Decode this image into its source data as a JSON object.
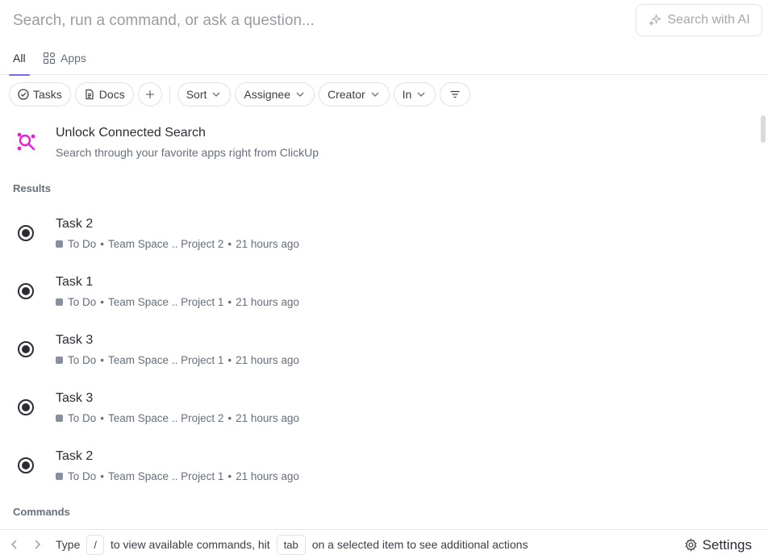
{
  "search": {
    "placeholder": "Search, run a command, or ask a question...",
    "ai_button_label": "Search with AI"
  },
  "tabs": [
    {
      "label": "All",
      "active": true
    },
    {
      "label": "Apps",
      "active": false
    }
  ],
  "filters": {
    "tasks_label": "Tasks",
    "docs_label": "Docs",
    "sort_label": "Sort",
    "assignee_label": "Assignee",
    "creator_label": "Creator",
    "in_label": "In"
  },
  "promo": {
    "title": "Unlock Connected Search",
    "subtitle": "Search through your favorite apps right from ClickUp"
  },
  "sections": {
    "results_label": "Results",
    "commands_label": "Commands"
  },
  "results": [
    {
      "title": "Task 2",
      "status": "To Do",
      "space": "Team Space",
      "project": "Project 2",
      "time": "21 hours ago"
    },
    {
      "title": "Task 1",
      "status": "To Do",
      "space": "Team Space",
      "project": "Project 1",
      "time": "21 hours ago"
    },
    {
      "title": "Task 3",
      "status": "To Do",
      "space": "Team Space",
      "project": "Project 1",
      "time": "21 hours ago"
    },
    {
      "title": "Task 3",
      "status": "To Do",
      "space": "Team Space",
      "project": "Project 2",
      "time": "21 hours ago"
    },
    {
      "title": "Task 2",
      "status": "To Do",
      "space": "Team Space",
      "project": "Project 1",
      "time": "21 hours ago"
    }
  ],
  "footer": {
    "type_label": "Type",
    "slash_key": "/",
    "middle_text": "to view available commands, hit",
    "tab_key": "tab",
    "end_text": "on a selected item to see additional actions",
    "settings_label": "Settings"
  },
  "colors": {
    "accent": "#7b68ee",
    "promo_icon": "#e91fd6",
    "status_todo": "#87909e"
  },
  "icons": {
    "ai": "sparkle-icon",
    "apps": "grid-icon",
    "tasks": "check-circle-icon",
    "docs": "doc-icon",
    "add": "plus-icon",
    "filter": "filter-lines-icon",
    "promo": "connected-search-icon",
    "task": "task-status-icon",
    "settings": "gear-icon"
  }
}
